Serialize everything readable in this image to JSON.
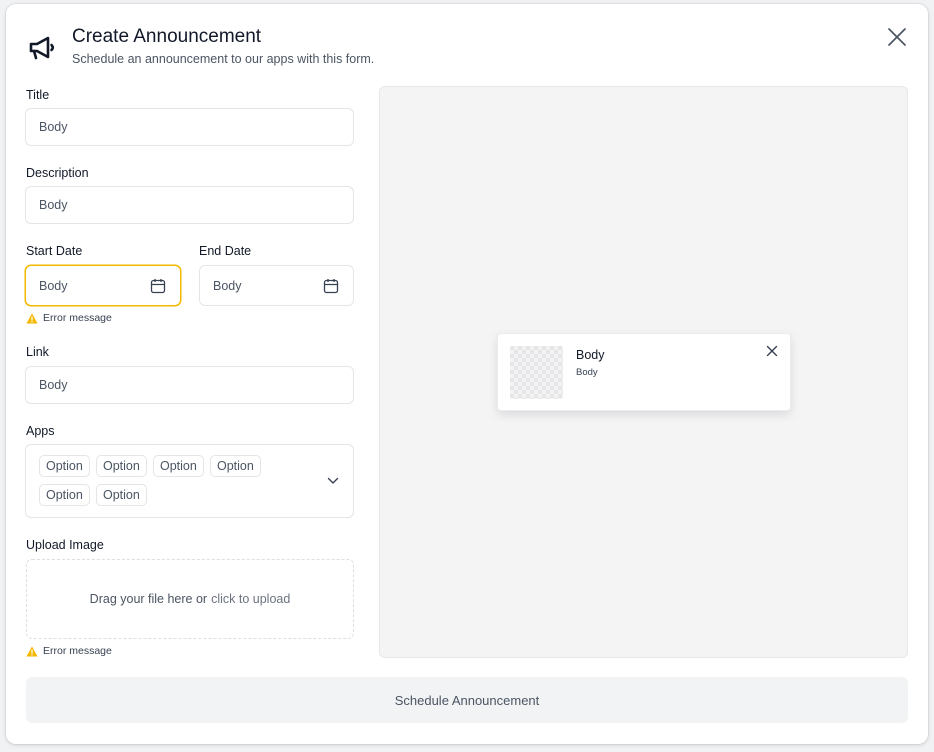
{
  "header": {
    "title": "Create Announcement",
    "subtitle": "Schedule an announcement to our apps with this form.",
    "icon": "megaphone-icon"
  },
  "form": {
    "title": {
      "label": "Title",
      "value": "Body"
    },
    "description": {
      "label": "Description",
      "value": "Body"
    },
    "start_date": {
      "label": "Start Date",
      "value": "Body",
      "error": "Error message"
    },
    "end_date": {
      "label": "End Date",
      "value": "Body"
    },
    "link": {
      "label": "Link",
      "value": "Body"
    },
    "apps": {
      "label": "Apps",
      "options": [
        "Option",
        "Option",
        "Option",
        "Option",
        "Option",
        "Option"
      ]
    },
    "upload": {
      "label": "Upload Image",
      "text": "Drag your file here or",
      "link": "click to upload",
      "error": "Error message"
    }
  },
  "preview": {
    "card_title": "Body",
    "card_body": "Body"
  },
  "submit_label": "Schedule Announcement",
  "colors": {
    "error_border": "#f5b800",
    "warning_icon": "#f5b800",
    "preview_bg": "#f4f4f5",
    "button_bg": "#f2f3f5"
  }
}
